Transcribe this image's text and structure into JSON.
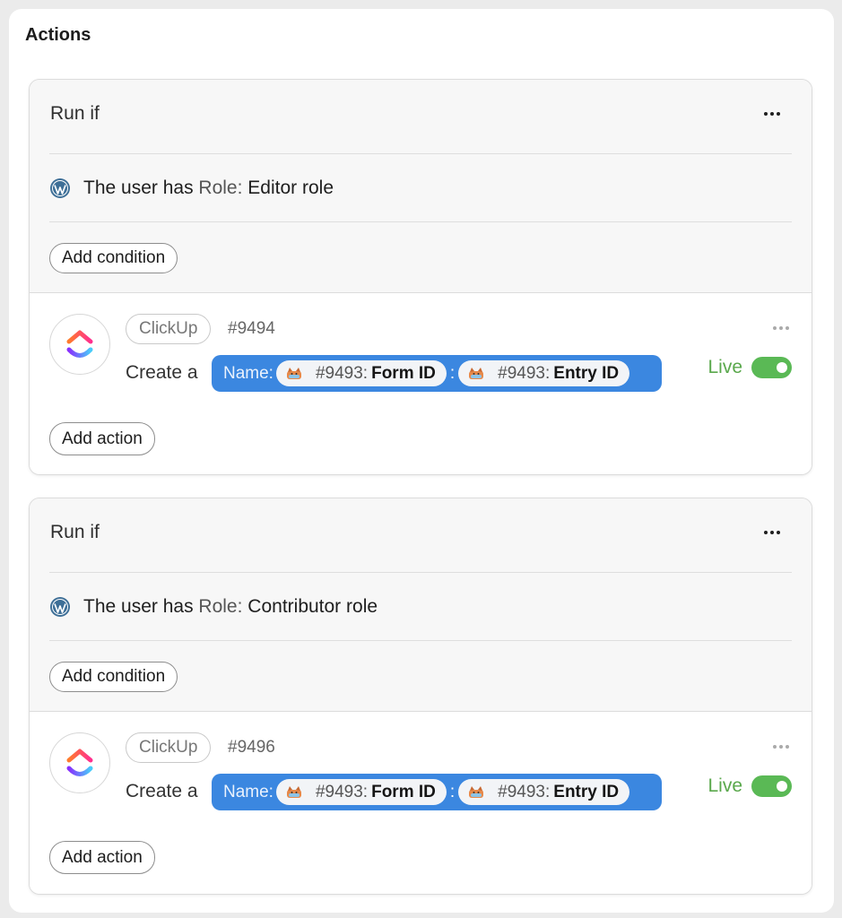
{
  "panel": {
    "title": "Actions"
  },
  "groups": [
    {
      "run_if_label": "Run if",
      "condition": {
        "prefix": "The user has",
        "field": "Role:",
        "value": "Editor",
        "suffix": "role"
      },
      "add_condition_label": "Add condition",
      "action": {
        "app": "ClickUp",
        "id": "#9494",
        "verb": "Create a",
        "name_label": "Name:",
        "tokens": [
          {
            "ref": "#9493:",
            "field": "Form ID"
          },
          {
            "ref": "#9493:",
            "field": "Entry ID"
          }
        ],
        "separator": ":",
        "status": "Live"
      },
      "add_action_label": "Add action"
    },
    {
      "run_if_label": "Run if",
      "condition": {
        "prefix": "The user has",
        "field": "Role:",
        "value": "Contributor",
        "suffix": "role"
      },
      "add_condition_label": "Add condition",
      "action": {
        "app": "ClickUp",
        "id": "#9496",
        "verb": "Create a",
        "name_label": "Name:",
        "tokens": [
          {
            "ref": "#9493:",
            "field": "Form ID"
          },
          {
            "ref": "#9493:",
            "field": "Entry ID"
          }
        ],
        "separator": ":",
        "status": "Live"
      },
      "add_action_label": "Add action"
    }
  ],
  "colors": {
    "pill_blue": "#3b87e0",
    "live_green": "#5aa84c",
    "toggle_green": "#5ab955",
    "wordpress_blue": "#3e6f97"
  },
  "icons": {
    "condition": "wordpress-icon",
    "app": "clickup-icon",
    "token": "formidable-cat-icon",
    "menu": "more-horizontal-icon"
  }
}
